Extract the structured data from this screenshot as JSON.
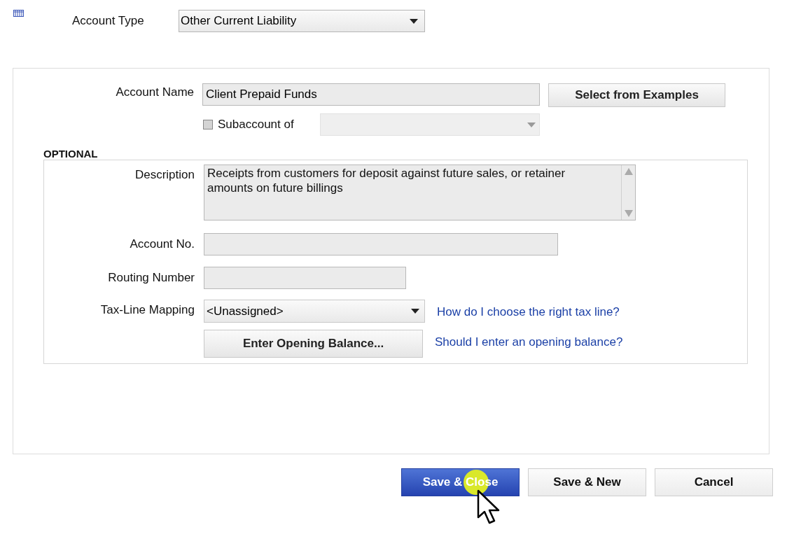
{
  "account_type": {
    "label": "Account Type",
    "value": "Other Current Liability"
  },
  "account_name": {
    "label": "Account Name",
    "value": "Client Prepaid Funds"
  },
  "examples_button": "Select from Examples",
  "subaccount": {
    "label": "Subaccount of",
    "checked": false,
    "disabled": true
  },
  "optional": {
    "title": "OPTIONAL",
    "description": {
      "label": "Description",
      "value": "Receipts from customers for deposit against future sales, or retainer amounts on future billings"
    },
    "account_no": {
      "label": "Account No."
    },
    "routing_number": {
      "label": "Routing Number"
    },
    "tax_line": {
      "label": "Tax-Line Mapping",
      "value": "<Unassigned>",
      "help_link": "How do I choose the right tax line?"
    },
    "opening_balance": {
      "button": "Enter Opening Balance...",
      "help_link": "Should I enter an opening balance?"
    }
  },
  "buttons": [
    {
      "label": "Save & Close",
      "kind": "primary"
    },
    {
      "label": "Save & New",
      "kind": "default"
    },
    {
      "label": "Cancel",
      "kind": "default"
    }
  ]
}
